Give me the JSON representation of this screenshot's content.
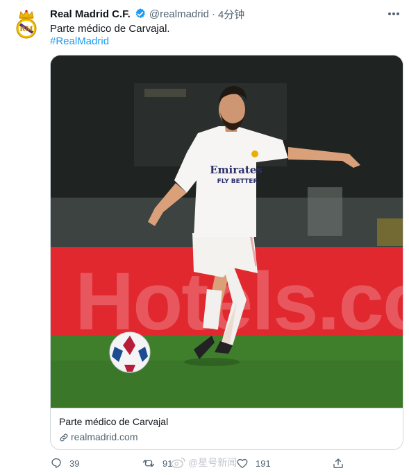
{
  "account": {
    "name": "Real Madrid C.F.",
    "handle": "@realmadrid",
    "separator": "·",
    "time": "4分钟"
  },
  "tweet": {
    "text": "Parte médico de Carvajal.",
    "hashtag": "#RealMadrid"
  },
  "card": {
    "title": "Parte médico de Carvajal",
    "domain": "realmadrid.com",
    "banner_text": "Hotels.co"
  },
  "actions": {
    "replies": "39",
    "retweets": "91",
    "likes": "191"
  },
  "watermark": {
    "text": "@星号新闻"
  },
  "colors": {
    "accent": "#1d9bf0",
    "text": "#0f1419",
    "muted": "#536471",
    "border": "#cfd9de",
    "banner_red": "#e1282f",
    "pitch_green": "#3f7f2c"
  },
  "icons": [
    "realmadrid-crest-icon",
    "verified-badge-icon",
    "more-icon",
    "link-icon",
    "reply-icon",
    "retweet-icon",
    "like-icon",
    "share-icon"
  ]
}
